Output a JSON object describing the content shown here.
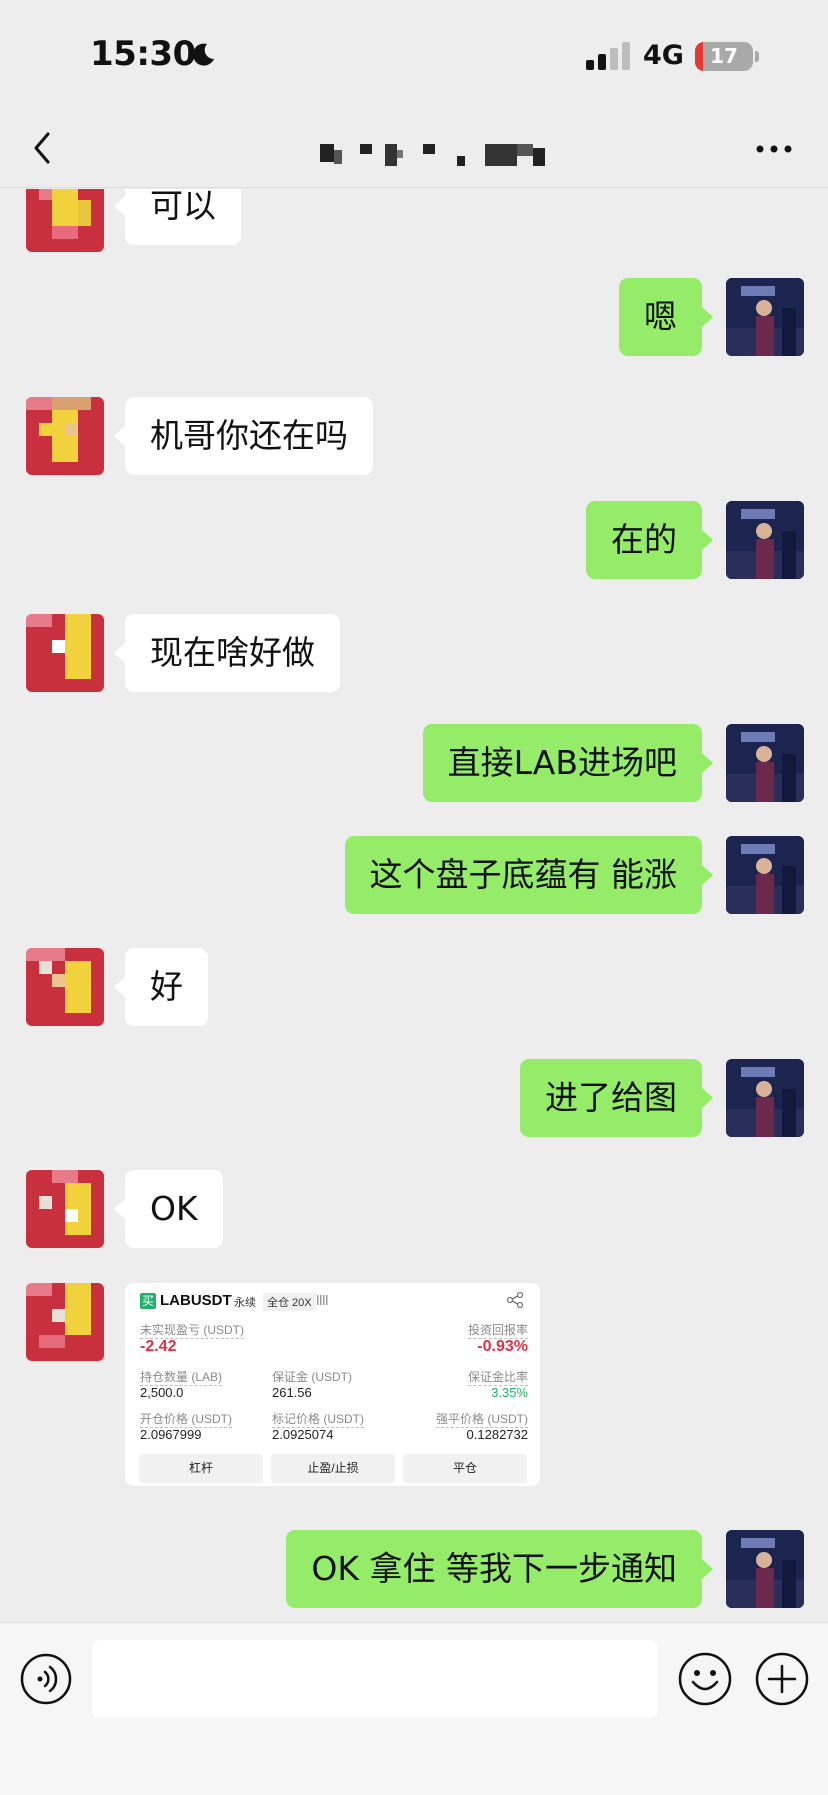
{
  "status_bar": {
    "time": "15:30",
    "network": "4G",
    "battery": "17"
  },
  "header": {
    "title_masked": true
  },
  "messages": [
    {
      "side": "in",
      "text": "可以"
    },
    {
      "side": "out",
      "text": "嗯"
    },
    {
      "side": "in",
      "text": "机哥你还在吗"
    },
    {
      "side": "out",
      "text": "在的"
    },
    {
      "side": "in",
      "text": "现在啥好做"
    },
    {
      "side": "out",
      "text": "直接LAB进场吧"
    },
    {
      "side": "out",
      "text": "这个盘子底蕴有 能涨"
    },
    {
      "side": "in",
      "text": "好"
    },
    {
      "side": "out",
      "text": "进了给图"
    },
    {
      "side": "in",
      "text": "OK"
    },
    {
      "side": "out",
      "text": "OK 拿住 等我下一步通知"
    }
  ],
  "trade_card": {
    "badge": "买",
    "symbol": "LABUSDT",
    "contract_type": "永续",
    "margin_mode": "全仓 20X",
    "unrealized_pnl_label": "未实现盈亏 (USDT)",
    "unrealized_pnl": "-2.42",
    "roi_label": "投资回报率",
    "roi": "-0.93%",
    "position_qty_label": "持仓数量 (LAB)",
    "position_qty": "2,500.0",
    "margin_label": "保证金 (USDT)",
    "margin": "261.56",
    "margin_ratio_label": "保证金比率",
    "margin_ratio": "3.35%",
    "entry_price_label": "开仓价格 (USDT)",
    "entry_price": "2.0967999",
    "mark_price_label": "标记价格 (USDT)",
    "mark_price": "2.0925074",
    "liq_price_label": "强平价格 (USDT)",
    "liq_price": "0.1282732",
    "buttons": [
      "杠杆",
      "止盈/止损",
      "平仓"
    ]
  },
  "input": {
    "value": ""
  },
  "colors": {
    "outgoing_bubble": "#95ec69",
    "incoming_bubble": "#ffffff",
    "background": "#ededed",
    "loss": "#e0314b",
    "profit": "#20b26c"
  }
}
